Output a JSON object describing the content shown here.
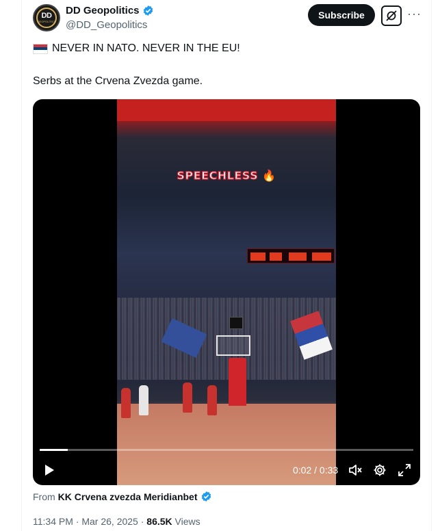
{
  "author": {
    "display_name": "DD Geopolitics",
    "handle": "@DD_Geopolitics",
    "avatar_text": "DD",
    "avatar_subtext": "GEOPOLITICS",
    "verified_icon": "verified-badge-icon"
  },
  "header_actions": {
    "subscribe_label": "Subscribe",
    "grok_icon": "grok-icon",
    "more_label": "···"
  },
  "tweet": {
    "line1": "NEVER IN NATO. NEVER IN THE EU!",
    "line1_flag": "serbia-flag-icon",
    "line2": "Serbs at the Crvena Zvezda game."
  },
  "video": {
    "overlay_text": "SPEECHLESS 🔥",
    "current_time": "0:02",
    "duration": "0:33",
    "time_display": "0:02 / 0:33",
    "progress_fraction": 0.075,
    "controls": [
      "play-icon",
      "mute-icon",
      "settings-gear-icon",
      "fullscreen-icon"
    ]
  },
  "attribution": {
    "prefix": "From",
    "source": "KK Crvena zvezda Meridianbet",
    "verified_icon": "verified-badge-icon"
  },
  "meta": {
    "time": "11:34 PM",
    "separator": "·",
    "date": "Mar 26, 2025",
    "views_count": "86.5K",
    "views_label": "Views"
  },
  "colors": {
    "verified_blue": "#1d9bf0",
    "text_primary": "#0f1419",
    "text_secondary": "#536471",
    "subscribe_bg": "#0f1419"
  }
}
